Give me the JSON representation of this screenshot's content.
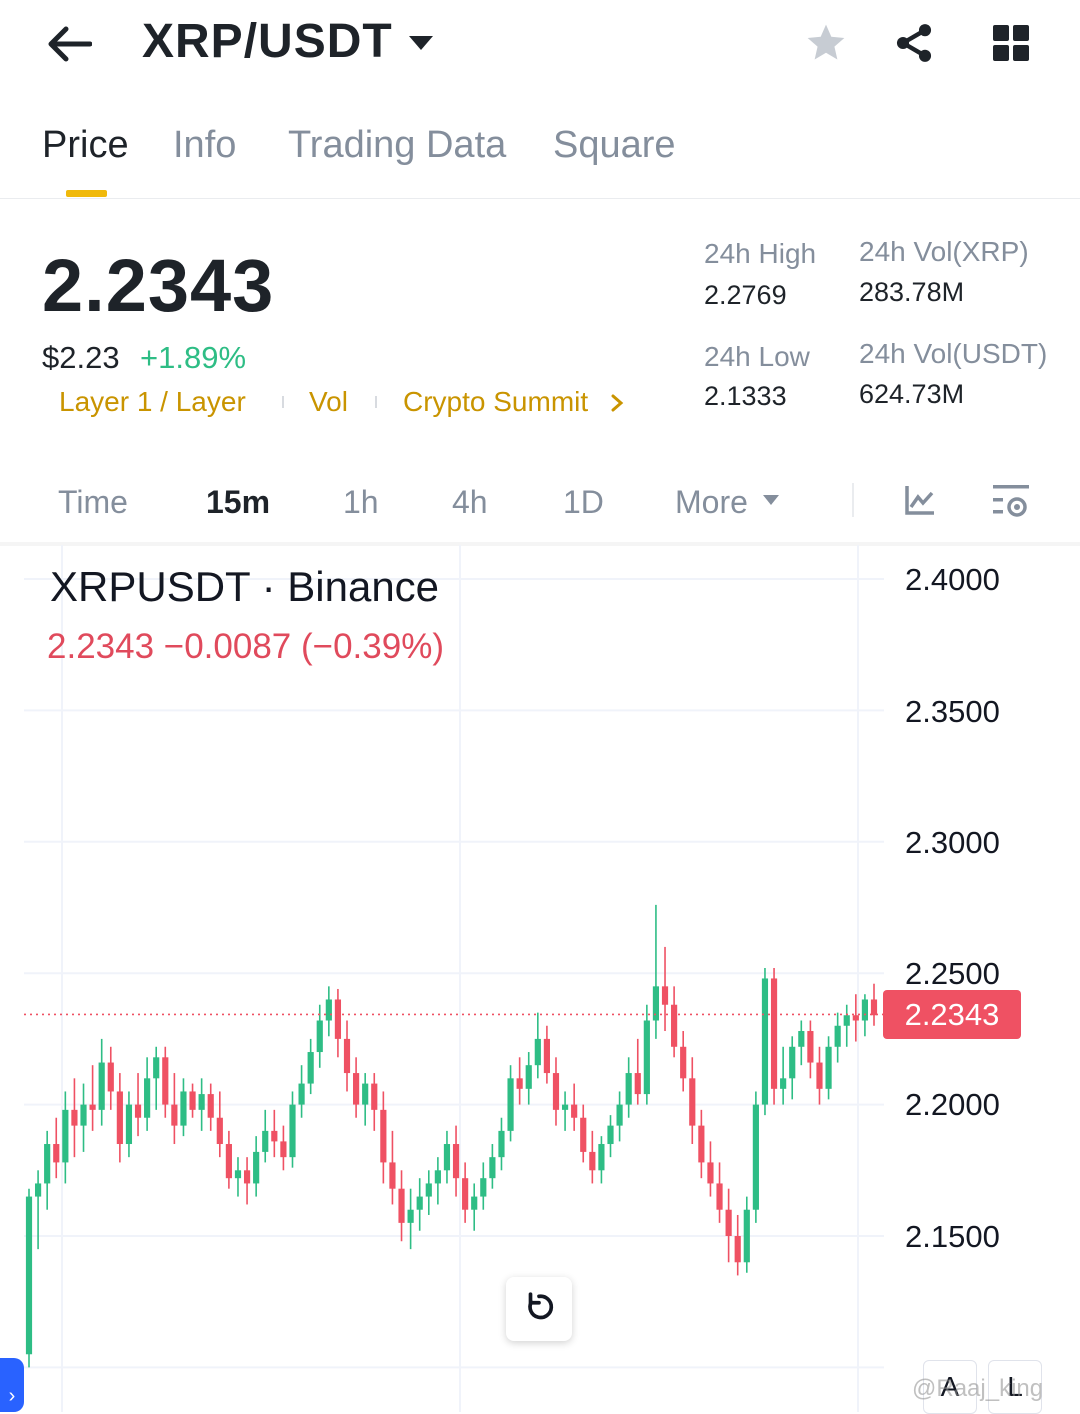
{
  "header": {
    "pair": "XRP/USDT",
    "icons": [
      "back-arrow-icon",
      "caret-down-icon",
      "star-icon",
      "share-icon",
      "grid-icon"
    ]
  },
  "tabs": [
    {
      "label": "Price",
      "active": true
    },
    {
      "label": "Info",
      "active": false
    },
    {
      "label": "Trading Data",
      "active": false
    },
    {
      "label": "Square",
      "active": false
    }
  ],
  "price": {
    "last": "2.2343",
    "usd": "$2.23",
    "change_pct": "+1.89%",
    "tags": [
      "Layer 1 / Layer",
      "Vol",
      "Crypto Summit"
    ]
  },
  "stats": {
    "high_label": "24h High",
    "high_value": "2.2769",
    "low_label": "24h Low",
    "low_value": "2.1333",
    "vol_base_label": "24h Vol(XRP)",
    "vol_base_value": "283.78M",
    "vol_quote_label": "24h Vol(USDT)",
    "vol_quote_value": "624.73M"
  },
  "intervals": {
    "time": "Time",
    "m15": "15m",
    "h1": "1h",
    "h4": "4h",
    "d1": "1D",
    "more": "More",
    "active": "15m"
  },
  "chart": {
    "symbol_line": "XRPUSDT · Binance",
    "price_line": "2.2343  −0.0087 (−0.39%)",
    "last_label": "2.2343",
    "watermark": "@Raaj_king",
    "corner_buttons": [
      "A",
      "L"
    ]
  },
  "colors": {
    "up": "#2ebd85",
    "down": "#ef5163",
    "accent": "#f0b90b",
    "tag": "#c99400"
  },
  "chart_data": {
    "type": "candlestick",
    "y_ticks": [
      "2.4000",
      "2.3500",
      "2.3000",
      "2.2500",
      "2.2000",
      "2.1500"
    ],
    "ylim": [
      2.1,
      2.42
    ],
    "last_price": 2.2343,
    "grid": true,
    "candles": [
      [
        2.105,
        2.168,
        2.1,
        2.165
      ],
      [
        2.165,
        2.175,
        2.145,
        2.17
      ],
      [
        2.17,
        2.19,
        2.16,
        2.185
      ],
      [
        2.185,
        2.195,
        2.172,
        2.178
      ],
      [
        2.178,
        2.205,
        2.17,
        2.198
      ],
      [
        2.198,
        2.21,
        2.18,
        2.192
      ],
      [
        2.192,
        2.208,
        2.182,
        2.2
      ],
      [
        2.2,
        2.215,
        2.19,
        2.198
      ],
      [
        2.198,
        2.225,
        2.192,
        2.216
      ],
      [
        2.216,
        2.222,
        2.198,
        2.205
      ],
      [
        2.205,
        2.212,
        2.178,
        2.185
      ],
      [
        2.185,
        2.205,
        2.18,
        2.2
      ],
      [
        2.2,
        2.212,
        2.188,
        2.195
      ],
      [
        2.195,
        2.218,
        2.19,
        2.21
      ],
      [
        2.21,
        2.222,
        2.198,
        2.218
      ],
      [
        2.218,
        2.222,
        2.195,
        2.2
      ],
      [
        2.2,
        2.212,
        2.185,
        2.192
      ],
      [
        2.192,
        2.21,
        2.188,
        2.205
      ],
      [
        2.205,
        2.208,
        2.195,
        2.198
      ],
      [
        2.198,
        2.21,
        2.19,
        2.204
      ],
      [
        2.204,
        2.208,
        2.19,
        2.195
      ],
      [
        2.195,
        2.205,
        2.18,
        2.185
      ],
      [
        2.185,
        2.19,
        2.168,
        2.172
      ],
      [
        2.172,
        2.18,
        2.165,
        2.175
      ],
      [
        2.175,
        2.18,
        2.162,
        2.17
      ],
      [
        2.17,
        2.188,
        2.165,
        2.182
      ],
      [
        2.182,
        2.198,
        2.178,
        2.19
      ],
      [
        2.19,
        2.198,
        2.18,
        2.186
      ],
      [
        2.186,
        2.192,
        2.175,
        2.18
      ],
      [
        2.18,
        2.205,
        2.176,
        2.2
      ],
      [
        2.2,
        2.215,
        2.195,
        2.208
      ],
      [
        2.208,
        2.225,
        2.204,
        2.22
      ],
      [
        2.22,
        2.238,
        2.214,
        2.232
      ],
      [
        2.232,
        2.245,
        2.226,
        2.24
      ],
      [
        2.24,
        2.244,
        2.218,
        2.225
      ],
      [
        2.225,
        2.232,
        2.205,
        2.212
      ],
      [
        2.212,
        2.218,
        2.195,
        2.2
      ],
      [
        2.2,
        2.212,
        2.192,
        2.208
      ],
      [
        2.208,
        2.212,
        2.19,
        2.198
      ],
      [
        2.198,
        2.205,
        2.17,
        2.178
      ],
      [
        2.178,
        2.19,
        2.162,
        2.168
      ],
      [
        2.168,
        2.175,
        2.148,
        2.155
      ],
      [
        2.155,
        2.168,
        2.145,
        2.16
      ],
      [
        2.16,
        2.172,
        2.152,
        2.165
      ],
      [
        2.165,
        2.175,
        2.158,
        2.17
      ],
      [
        2.17,
        2.18,
        2.162,
        2.175
      ],
      [
        2.175,
        2.19,
        2.17,
        2.185
      ],
      [
        2.185,
        2.192,
        2.165,
        2.172
      ],
      [
        2.172,
        2.178,
        2.155,
        2.16
      ],
      [
        2.16,
        2.17,
        2.152,
        2.165
      ],
      [
        2.165,
        2.178,
        2.16,
        2.172
      ],
      [
        2.172,
        2.185,
        2.168,
        2.18
      ],
      [
        2.18,
        2.195,
        2.175,
        2.19
      ],
      [
        2.19,
        2.215,
        2.186,
        2.21
      ],
      [
        2.21,
        2.218,
        2.2,
        2.206
      ],
      [
        2.206,
        2.22,
        2.2,
        2.215
      ],
      [
        2.215,
        2.235,
        2.21,
        2.225
      ],
      [
        2.225,
        2.23,
        2.208,
        2.212
      ],
      [
        2.212,
        2.218,
        2.192,
        2.198
      ],
      [
        2.198,
        2.205,
        2.19,
        2.2
      ],
      [
        2.2,
        2.208,
        2.19,
        2.195
      ],
      [
        2.195,
        2.2,
        2.178,
        2.182
      ],
      [
        2.182,
        2.19,
        2.17,
        2.175
      ],
      [
        2.175,
        2.188,
        2.17,
        2.185
      ],
      [
        2.185,
        2.196,
        2.18,
        2.192
      ],
      [
        2.192,
        2.205,
        2.186,
        2.2
      ],
      [
        2.2,
        2.218,
        2.195,
        2.212
      ],
      [
        2.212,
        2.225,
        2.2,
        2.204
      ],
      [
        2.204,
        2.238,
        2.2,
        2.232
      ],
      [
        2.232,
        2.276,
        2.225,
        2.245
      ],
      [
        2.245,
        2.26,
        2.228,
        2.238
      ],
      [
        2.238,
        2.245,
        2.218,
        2.222
      ],
      [
        2.222,
        2.228,
        2.205,
        2.21
      ],
      [
        2.21,
        2.218,
        2.185,
        2.192
      ],
      [
        2.192,
        2.198,
        2.172,
        2.178
      ],
      [
        2.178,
        2.186,
        2.165,
        2.17
      ],
      [
        2.17,
        2.178,
        2.155,
        2.16
      ],
      [
        2.16,
        2.168,
        2.14,
        2.15
      ],
      [
        2.15,
        2.158,
        2.135,
        2.14
      ],
      [
        2.14,
        2.165,
        2.136,
        2.16
      ],
      [
        2.16,
        2.205,
        2.155,
        2.2
      ],
      [
        2.2,
        2.252,
        2.196,
        2.248
      ],
      [
        2.248,
        2.252,
        2.2,
        2.206
      ],
      [
        2.206,
        2.222,
        2.2,
        2.21
      ],
      [
        2.21,
        2.226,
        2.202,
        2.222
      ],
      [
        2.222,
        2.232,
        2.215,
        2.228
      ],
      [
        2.228,
        2.232,
        2.21,
        2.216
      ],
      [
        2.216,
        2.222,
        2.2,
        2.206
      ],
      [
        2.206,
        2.226,
        2.202,
        2.222
      ],
      [
        2.222,
        2.235,
        2.216,
        2.23
      ],
      [
        2.23,
        2.238,
        2.222,
        2.234
      ],
      [
        2.234,
        2.242,
        2.224,
        2.232
      ],
      [
        2.232,
        2.242,
        2.226,
        2.24
      ],
      [
        2.24,
        2.246,
        2.23,
        2.234
      ]
    ]
  }
}
